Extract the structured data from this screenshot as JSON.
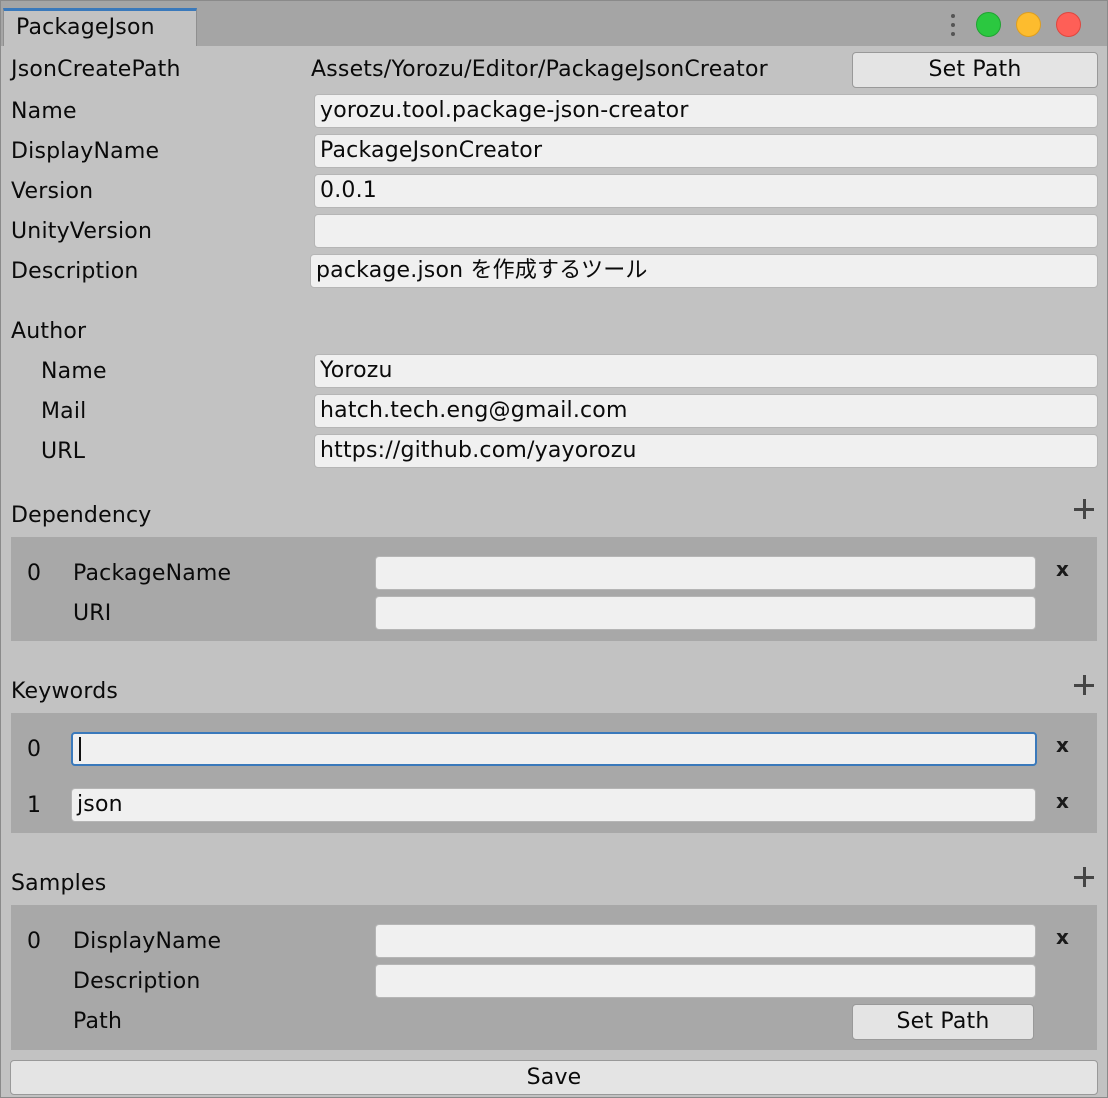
{
  "window": {
    "tab_title": "PackageJson"
  },
  "json_create_path": {
    "label": "JsonCreatePath",
    "value": "Assets/Yorozu/Editor/PackageJsonCreator",
    "button": "Set Path"
  },
  "fields": {
    "name": {
      "label": "Name",
      "value": "yorozu.tool.package-json-creator"
    },
    "display_name": {
      "label": "DisplayName",
      "value": "PackageJsonCreator"
    },
    "version": {
      "label": "Version",
      "value": "0.0.1"
    },
    "unity_version": {
      "label": "UnityVersion",
      "value": ""
    },
    "description": {
      "label": "Description",
      "value": "package.json を作成するツール"
    }
  },
  "author": {
    "header": "Author",
    "name": {
      "label": "Name",
      "value": "Yorozu"
    },
    "mail": {
      "label": "Mail",
      "value": "hatch.tech.eng@gmail.com"
    },
    "url": {
      "label": "URL",
      "value": "https://github.com/yayorozu"
    }
  },
  "dependency": {
    "header": "Dependency",
    "items": [
      {
        "index": "0",
        "package_name_label": "PackageName",
        "package_name": "",
        "uri_label": "URI",
        "uri": "",
        "remove": "x"
      }
    ]
  },
  "keywords": {
    "header": "Keywords",
    "items": [
      {
        "index": "0",
        "value": "",
        "remove": "x"
      },
      {
        "index": "1",
        "value": "json",
        "remove": "x"
      }
    ]
  },
  "samples": {
    "header": "Samples",
    "items": [
      {
        "index": "0",
        "display_name_label": "DisplayName",
        "display_name": "",
        "description_label": "Description",
        "description": "",
        "path_label": "Path",
        "path_button": "Set Path",
        "remove": "x"
      }
    ]
  },
  "save_button": "Save",
  "icons": {
    "add": "plus-icon",
    "remove": "x-icon",
    "menu": "kebab-menu-icon"
  },
  "colors": {
    "accent": "#3a79bb",
    "traffic_green": "#2bc840",
    "traffic_yellow": "#fdbc2e",
    "traffic_red": "#fe5f57"
  }
}
